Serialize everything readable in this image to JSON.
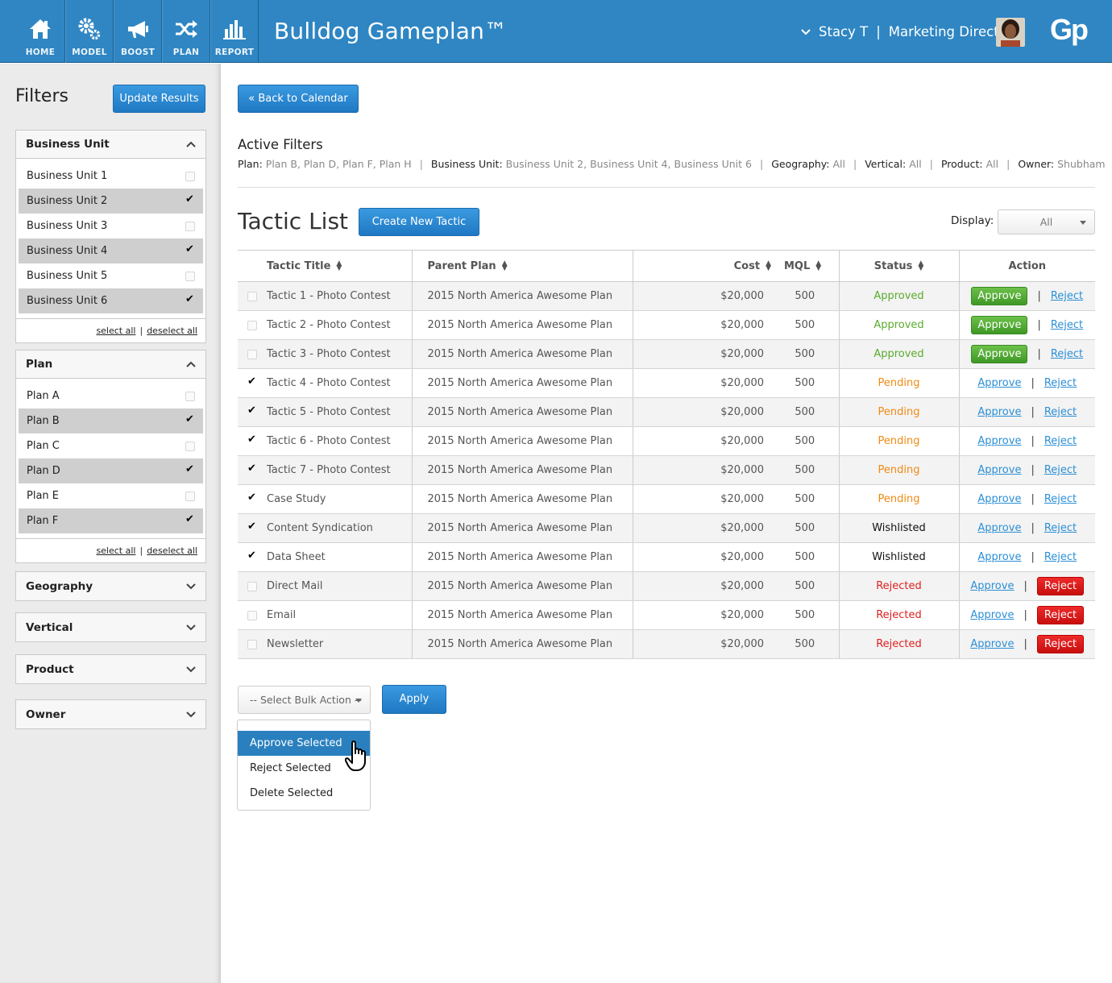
{
  "header": {
    "nav": [
      {
        "label": "HOME",
        "icon": "home-icon"
      },
      {
        "label": "MODEL",
        "icon": "gears-icon"
      },
      {
        "label": "BOOST",
        "icon": "megaphone-icon"
      },
      {
        "label": "PLAN",
        "icon": "shuffle-icon"
      },
      {
        "label": "REPORT",
        "icon": "bar-chart-icon"
      }
    ],
    "title": "Bulldog Gameplan™",
    "user_name": "Stacy T",
    "user_sep": "|",
    "user_role": "Marketing Director",
    "logo": "Gp",
    "accent": "#2f86c3"
  },
  "sidebar": {
    "title": "Filters",
    "update_label": "Update Results",
    "business_unit": {
      "title": "Business Unit",
      "items": [
        {
          "label": "Business Unit 1",
          "checked": false
        },
        {
          "label": "Business Unit 2",
          "checked": true
        },
        {
          "label": "Business Unit 3",
          "checked": false
        },
        {
          "label": "Business Unit 4",
          "checked": true
        },
        {
          "label": "Business Unit 5",
          "checked": false
        },
        {
          "label": "Business Unit 6",
          "checked": true
        }
      ],
      "select_all": "select all",
      "deselect_all": "deselect all"
    },
    "plan": {
      "title": "Plan",
      "items": [
        {
          "label": "Plan A",
          "checked": false
        },
        {
          "label": "Plan B",
          "checked": true
        },
        {
          "label": "Plan C",
          "checked": false
        },
        {
          "label": "Plan D",
          "checked": true
        },
        {
          "label": "Plan E",
          "checked": false
        },
        {
          "label": "Plan F",
          "checked": true
        }
      ],
      "select_all": "select all",
      "deselect_all": "deselect all"
    },
    "geography": "Geography",
    "vertical": "Vertical",
    "product": "Product",
    "owner": "Owner",
    "sep": "|"
  },
  "main": {
    "back_label": "« Back to Calendar",
    "active_title": "Active Filters",
    "active_filters": [
      {
        "label": "Plan:",
        "value": "Plan B, Plan D, Plan F, Plan H"
      },
      {
        "label": "Business Unit:",
        "value": "Business Unit 2, Business Unit 4, Business Unit 6"
      },
      {
        "label": "Geography:",
        "value": "All"
      },
      {
        "label": "Vertical:",
        "value": "All"
      },
      {
        "label": "Product:",
        "value": "All"
      },
      {
        "label": "Owner:",
        "value": "Shubham"
      }
    ],
    "tactic_title": "Tactic List",
    "create_label": "Create New Tactic",
    "display_label": "Display:",
    "display_value": "All",
    "columns": {
      "title": "Tactic Title",
      "plan": "Parent Plan",
      "cost": "Cost",
      "mql": "MQL",
      "status": "Status",
      "action": "Action"
    },
    "approve_label": "Approve",
    "reject_label": "Reject",
    "pipe": "|",
    "rows": [
      {
        "title": "Tactic 1 - Photo Contest",
        "plan": "2015 North America Awesome Plan",
        "cost": "$20,000",
        "mql": "500",
        "status": "Approved",
        "checked": false
      },
      {
        "title": "Tactic 2 - Photo Contest",
        "plan": "2015 North America Awesome Plan",
        "cost": "$20,000",
        "mql": "500",
        "status": "Approved",
        "checked": false
      },
      {
        "title": "Tactic 3 - Photo Contest",
        "plan": "2015 North America Awesome Plan",
        "cost": "$20,000",
        "mql": "500",
        "status": "Approved",
        "checked": false
      },
      {
        "title": "Tactic 4 - Photo Contest",
        "plan": "2015 North America Awesome Plan",
        "cost": "$20,000",
        "mql": "500",
        "status": "Pending",
        "checked": true
      },
      {
        "title": "Tactic 5 - Photo Contest",
        "plan": "2015 North America Awesome Plan",
        "cost": "$20,000",
        "mql": "500",
        "status": "Pending",
        "checked": true
      },
      {
        "title": "Tactic 6 - Photo Contest",
        "plan": "2015 North America Awesome Plan",
        "cost": "$20,000",
        "mql": "500",
        "status": "Pending",
        "checked": true
      },
      {
        "title": "Tactic 7 - Photo Contest",
        "plan": "2015 North America Awesome Plan",
        "cost": "$20,000",
        "mql": "500",
        "status": "Pending",
        "checked": true
      },
      {
        "title": "Case Study",
        "plan": "2015 North America Awesome Plan",
        "cost": "$20,000",
        "mql": "500",
        "status": "Pending",
        "checked": true
      },
      {
        "title": "Content Syndication",
        "plan": "2015 North America Awesome Plan",
        "cost": "$20,000",
        "mql": "500",
        "status": "Wishlisted",
        "checked": true
      },
      {
        "title": "Data Sheet",
        "plan": "2015 North America Awesome Plan",
        "cost": "$20,000",
        "mql": "500",
        "status": "Wishlisted",
        "checked": true
      },
      {
        "title": "Direct Mail",
        "plan": "2015 North America Awesome Plan",
        "cost": "$20,000",
        "mql": "500",
        "status": "Rejected",
        "checked": false
      },
      {
        "title": "Email",
        "plan": "2015 North America Awesome Plan",
        "cost": "$20,000",
        "mql": "500",
        "status": "Rejected",
        "checked": false
      },
      {
        "title": "Newsletter",
        "plan": "2015 North America Awesome Plan",
        "cost": "$20,000",
        "mql": "500",
        "status": "Rejected",
        "checked": false
      }
    ],
    "bulk_placeholder": "-- Select Bulk Action --",
    "apply_label": "Apply",
    "bulk_options": [
      "Approve Selected",
      "Reject Selected",
      "Delete Selected"
    ],
    "status_colors": {
      "Approved": "#5aab2d",
      "Pending": "#f08a12",
      "Wishlisted": "#111111",
      "Rejected": "#e02020"
    }
  }
}
